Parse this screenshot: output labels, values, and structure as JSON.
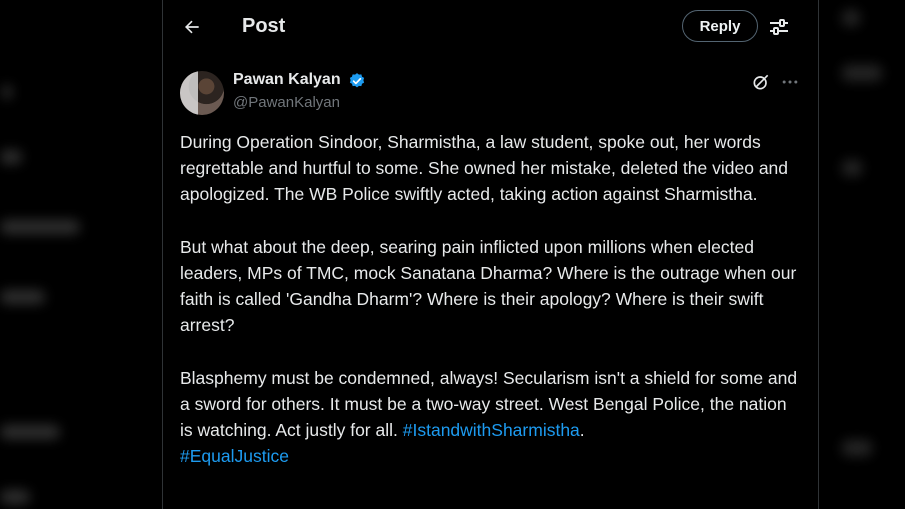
{
  "header": {
    "back_icon": "arrow-left-icon",
    "title": "Post",
    "reply_label": "Reply",
    "filter_icon": "sliders-icon"
  },
  "tweet": {
    "author": {
      "name": "Pawan Kalyan",
      "handle": "@PawanKalyan",
      "verified": true,
      "verified_color": "#1d9bf0"
    },
    "paragraphs": [
      "During Operation Sindoor, Sharmistha, a law student, spoke out, her words regrettable and hurtful to some. She owned her mistake, deleted the video and apologized. The WB Police swiftly acted, taking action against Sharmistha.",
      "But what about the deep, searing pain inflicted upon millions when elected leaders, MPs of TMC, mock Sanatana Dharma? Where is the outrage when our faith is called 'Gandha Dharm'? Where is their apology? Where is their swift arrest?",
      "Blasphemy must be condemned, always! Secularism isn't a shield for some and a sword for others. It must be a two-way street. West Bengal Police, the nation is watching. Act justly for all."
    ],
    "hashtags": [
      "#IstandwithSharmistha",
      "#EqualJustice"
    ],
    "trailing_period": ".",
    "hashtag_color": "#1d9bf0"
  },
  "theme": {
    "background": "#000000",
    "text": "#e7e9ea",
    "muted": "#71767b",
    "border": "#2f3336"
  }
}
